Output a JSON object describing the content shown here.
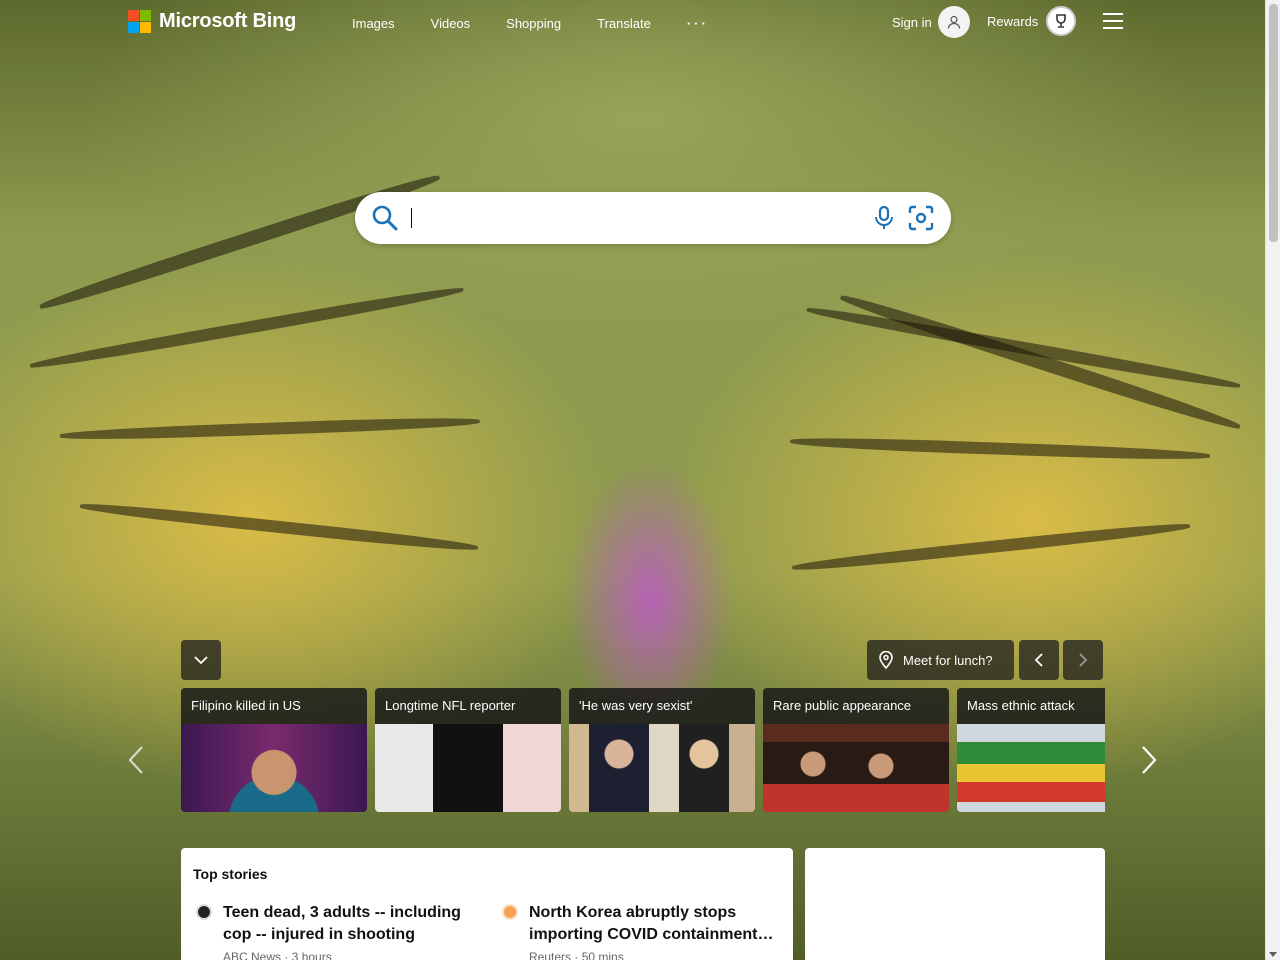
{
  "header": {
    "logo_text": "Microsoft Bing",
    "nav": [
      "Images",
      "Videos",
      "Shopping",
      "Translate"
    ],
    "more_label": "···",
    "signin_label": "Sign in",
    "rewards_label": "Rewards"
  },
  "search": {
    "value": "",
    "placeholder": ""
  },
  "widgets": {
    "lunch_label": "Meet for lunch?"
  },
  "news_cards": [
    {
      "title": "Filipino killed in US"
    },
    {
      "title": "Longtime NFL reporter"
    },
    {
      "title": "'He was very sexist'"
    },
    {
      "title": "Rare public appearance"
    },
    {
      "title": "Mass ethnic attack"
    }
  ],
  "top_stories": {
    "heading": "Top stories",
    "items": [
      {
        "headline": "Teen dead, 3 adults -- including cop -- injured in shooting",
        "source": "ABC News",
        "time": "3 hours"
      },
      {
        "headline": "North Korea abruptly stops importing COVID containment…",
        "source": "Reuters",
        "time": "50 mins"
      }
    ]
  },
  "icons": [
    "search-icon",
    "microphone-icon",
    "visual-search-icon",
    "user-avatar-icon",
    "rewards-trophy-icon",
    "hamburger-menu-icon",
    "chevron-down-icon",
    "location-pin-icon",
    "chevron-left-icon",
    "chevron-right-icon"
  ]
}
